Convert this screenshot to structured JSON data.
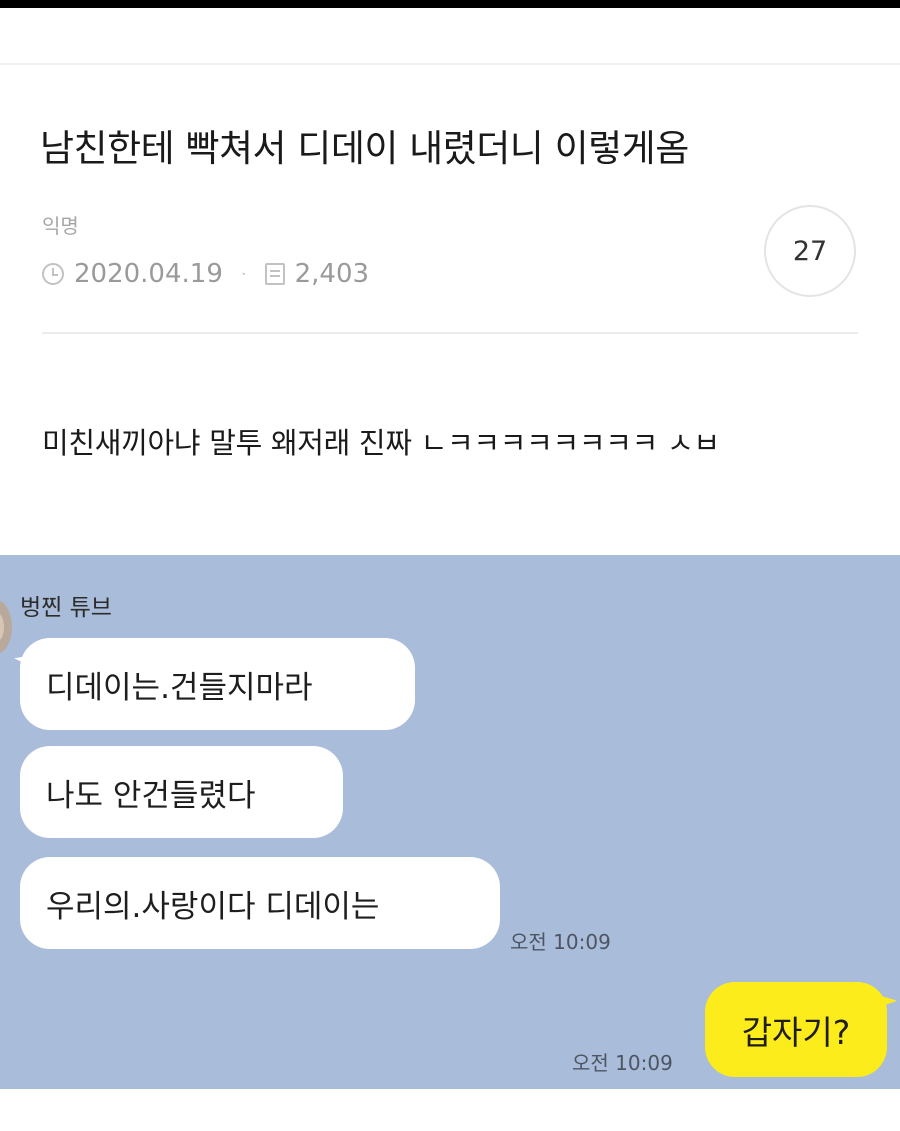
{
  "post": {
    "title": "남친한테 빡쳐서 디데이 내렸더니 이렇게옴",
    "author": "익명",
    "date": "2020.04.19",
    "views": "2,403",
    "comment_count": "27",
    "body": "미친새끼아냐 말투 왜저래 진짜 ㄴㅋㅋㅋㅋㅋㅋㅋㅋ ㅅㅂ"
  },
  "chat": {
    "sender_name": "벙찐 튜브",
    "received_messages": [
      "디데이는.건들지마라",
      "나도 안건들렸다",
      "우리의.사랑이다 디데이는"
    ],
    "received_time": "오전 10:09",
    "sent_message": "갑자기?",
    "sent_time": "오전 10:09"
  },
  "icons": {
    "date": "clock-icon",
    "views": "views-icon"
  },
  "colors": {
    "chat_background": "#a9bcd9",
    "sent_bubble": "#fdec1b",
    "received_bubble": "#ffffff"
  }
}
